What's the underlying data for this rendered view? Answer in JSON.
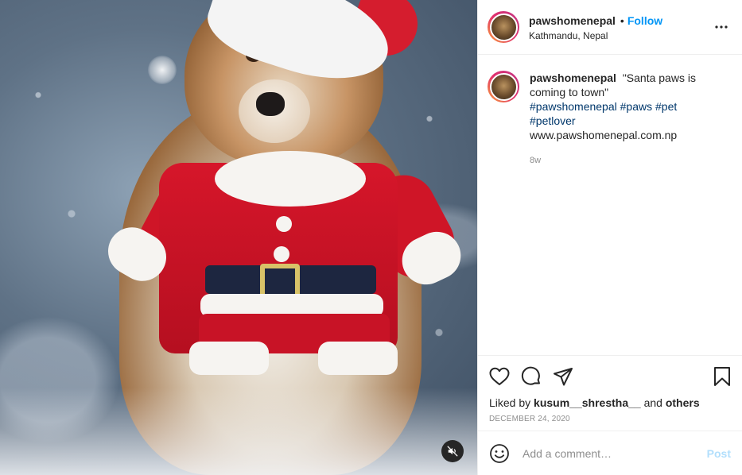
{
  "post": {
    "media": {
      "alt_hint": "dog-in-santa-costume",
      "muted": true,
      "mute_icon": "volume-mute-icon"
    },
    "header": {
      "username": "pawshomenepal",
      "separator": "•",
      "follow_label": "Follow",
      "location": "Kathmandu, Nepal",
      "more_icon": "more-options-icon"
    },
    "caption": {
      "username": "pawshomenepal",
      "text": "\"Santa paws is coming to town\"",
      "hashtags": [
        "#pawshomenepal",
        "#paws",
        "#pet",
        "#petlover"
      ],
      "link": "www.pawshomenepal.com.np",
      "time_ago": "8w"
    },
    "actions": {
      "like_icon": "heart-icon",
      "comment_icon": "comment-icon",
      "share_icon": "send-icon",
      "save_icon": "bookmark-icon"
    },
    "likes": {
      "prefix": "Liked by",
      "user": "kusum__shrestha__",
      "joiner": "and",
      "others": "others"
    },
    "date": "DECEMBER 24, 2020",
    "comment": {
      "emoji_icon": "emoji-icon",
      "placeholder": "Add a comment…",
      "post_label": "Post"
    },
    "colors": {
      "accent": "#0095f6",
      "hashtag": "#00376b",
      "post_disabled": "#b2dffc",
      "muted_text": "#8e8e8e"
    }
  }
}
